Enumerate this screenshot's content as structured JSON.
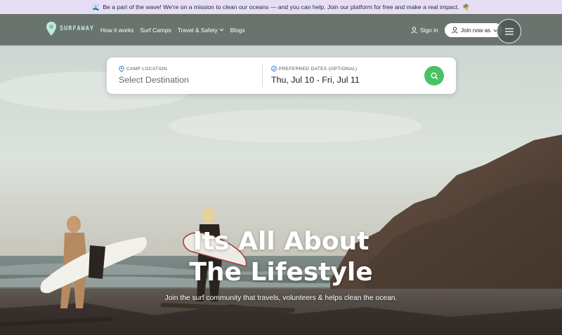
{
  "announcement": {
    "emoji_left": "🌊",
    "text": "Be a part of the wave! We're on a mission to clean our oceans — and you can help. Join our platform for free and make a real impact.",
    "emoji_right": "🌴"
  },
  "nav": {
    "logo_text": "SURFAWAY",
    "links": [
      "How it works",
      "Surf Camps",
      "Travel & Safety",
      "Blogs"
    ],
    "sign_in": "Sign in",
    "join_label": "Join now as"
  },
  "search": {
    "location_label": "CAMP LOCATION",
    "location_placeholder": "Select Destination",
    "dates_label": "PREFERRED DATES (OPTIONAL)",
    "dates_value": "Thu, Jul 10 - Fri, Jul 11"
  },
  "hero": {
    "headline_line1": "Its All About",
    "headline_line2": "The Lifestyle",
    "tagline": "Join the surf community that travels, volunteers & helps clean the ocean."
  },
  "colors": {
    "announcement_bg": "#e6def5",
    "nav_bg": "#626b65",
    "accent_green": "#4cc067",
    "logo_teal": "#bfe9df"
  },
  "icons": {
    "logo": "location-pin-icon",
    "user": "user-icon",
    "menu": "hamburger-menu-icon",
    "search": "search-icon",
    "calendar": "calendar-icon",
    "location": "map-pin-icon",
    "chevron": "chevron-down-icon"
  }
}
